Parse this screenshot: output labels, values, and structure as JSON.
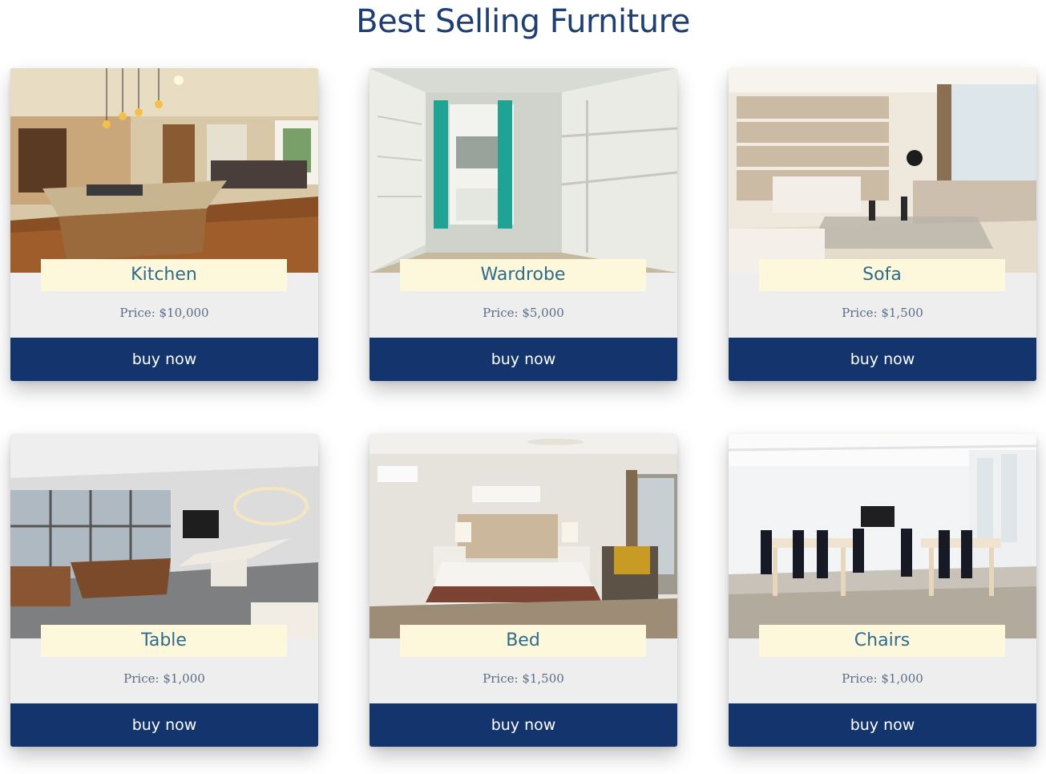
{
  "page": {
    "title": "Best Selling Furniture"
  },
  "colors": {
    "title": "#1f3e72",
    "button": "#13346d",
    "name_plate": "#fdf8dc",
    "card_background": "#eeeeef"
  },
  "products": [
    {
      "name": "Kitchen",
      "price": "Price: $10,000",
      "button": "buy now",
      "image": "kitchen-photo"
    },
    {
      "name": "Wardrobe",
      "price": "Price: $5,000",
      "button": "buy now",
      "image": "wardrobe-photo"
    },
    {
      "name": "Sofa",
      "price": "Price: $1,500",
      "button": "buy now",
      "image": "sofa-photo"
    },
    {
      "name": "Table",
      "price": "Price: $1,000",
      "button": "buy now",
      "image": "table-photo"
    },
    {
      "name": "Bed",
      "price": "Price: $1,500",
      "button": "buy now",
      "image": "bed-photo"
    },
    {
      "name": "Chairs",
      "price": "Price: $1,000",
      "button": "buy now",
      "image": "chairs-photo"
    }
  ]
}
